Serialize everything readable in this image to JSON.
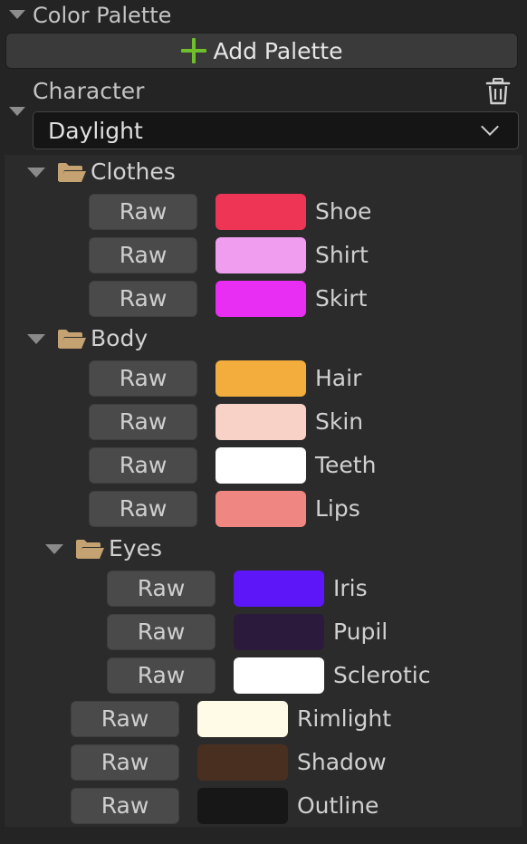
{
  "section": {
    "title": "Color Palette"
  },
  "toolbar": {
    "add_label": "Add Palette"
  },
  "palette": {
    "name_label": "Character",
    "selected": "Daylight"
  },
  "raw_label": "Raw",
  "groups": {
    "clothes": {
      "label": "Clothes",
      "items": [
        {
          "label": "Shoe",
          "color": "#ee3556"
        },
        {
          "label": "Shirt",
          "color": "#f09df0"
        },
        {
          "label": "Skirt",
          "color": "#e82ef2"
        }
      ]
    },
    "body": {
      "label": "Body",
      "items": [
        {
          "label": "Hair",
          "color": "#f3ad3c"
        },
        {
          "label": "Skin",
          "color": "#f8d2c7"
        },
        {
          "label": "Teeth",
          "color": "#ffffff"
        },
        {
          "label": "Lips",
          "color": "#f08681"
        }
      ]
    },
    "eyes": {
      "label": "Eyes",
      "items": [
        {
          "label": "Iris",
          "color": "#5d16f8"
        },
        {
          "label": "Pupil",
          "color": "#2c1a3c"
        },
        {
          "label": "Sclerotic",
          "color": "#ffffff"
        }
      ]
    },
    "root": {
      "items": [
        {
          "label": "Rimlight",
          "color": "#fffbe6"
        },
        {
          "label": "Shadow",
          "color": "#492f1f"
        },
        {
          "label": "Outline",
          "color": "#171717"
        }
      ]
    }
  }
}
